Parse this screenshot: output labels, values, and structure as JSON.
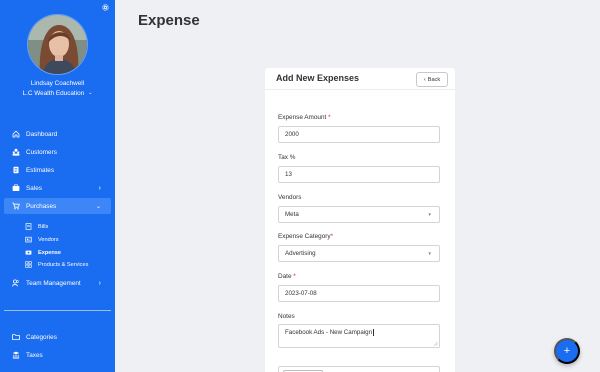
{
  "user": {
    "name": "Lindsay Coachwell",
    "organization": "L.C Wealth Education"
  },
  "nav": {
    "dashboard": "Dashboard",
    "customers": "Customers",
    "estimates": "Estimates",
    "sales": "Sales",
    "purchases": "Purchases",
    "purchases_sub": {
      "bills": "Bills",
      "vendors": "Vendors",
      "expense": "Expense",
      "products_services": "Products & Services"
    },
    "team_management": "Team Management",
    "categories": "Categories",
    "taxes": "Taxes"
  },
  "page": {
    "title": "Expense"
  },
  "form": {
    "title": "Add New Expenses",
    "back_label": "Back",
    "fields": {
      "expense_amount": {
        "label": "Expense Amount",
        "value": "2000",
        "required": "*"
      },
      "tax": {
        "label": "Tax %",
        "value": "13"
      },
      "vendors": {
        "label": "Vendors",
        "value": "Meta"
      },
      "expense_category": {
        "label": "Expense Category",
        "value": "Advertising",
        "required": "*"
      },
      "date": {
        "label": "Date",
        "value": "2023-07-08",
        "required": "*"
      },
      "notes": {
        "label": "Notes",
        "value": "Facebook Ads - New Campaign"
      }
    }
  },
  "fab": {
    "label": "+"
  },
  "colors": {
    "primary": "#1a6cf0",
    "sidebar_active": "#3d86f7",
    "background": "#eef0f4",
    "required": "#dd2222"
  },
  "icons": [
    "settings-gear-icon",
    "home-icon",
    "customers-icon",
    "document-icon",
    "sales-icon",
    "cart-icon",
    "bills-icon",
    "vendors-icon",
    "expense-icon",
    "products-icon",
    "team-icon",
    "folder-icon",
    "taxes-icon",
    "chevron-down-icon",
    "chevron-right-icon",
    "caret-down-icon",
    "resize-grip-icon",
    "plus-icon"
  ]
}
